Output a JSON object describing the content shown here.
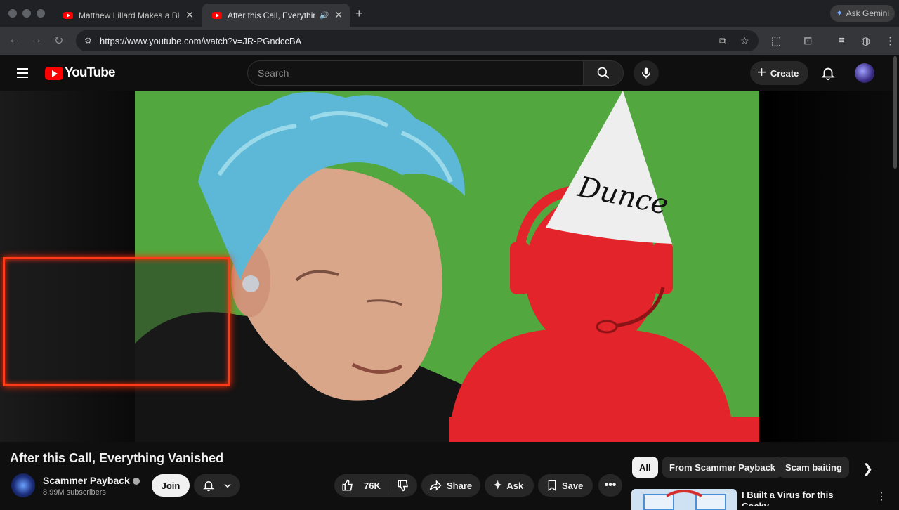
{
  "browser": {
    "tabs": [
      {
        "title": "Matthew Lillard Makes a Bloo",
        "active": false
      },
      {
        "title": "After this Call, Everything",
        "active": true
      }
    ],
    "ask_gemini": "Ask Gemini",
    "url": "https://www.youtube.com/watch?v=JR-PGndccBA"
  },
  "youtube": {
    "logo_text": "YouTube",
    "search_placeholder": "Search",
    "create_label": "Create",
    "video": {
      "hat_text": "Dunce",
      "title": "After this Call, Everything Vanished"
    },
    "channel": {
      "name": "Scammer Payback",
      "subscribers": "8.99M subscribers",
      "join_label": "Join"
    },
    "actions": {
      "likes": "76K",
      "share": "Share",
      "ask": "Ask",
      "save": "Save"
    },
    "chips": [
      "All",
      "From Scammer Payback",
      "Scam baiting"
    ],
    "recommendation": {
      "title": "I Built a Virus for this Cocky"
    }
  },
  "colors": {
    "brand_red": "#ff0000",
    "chip_bg": "#272727",
    "background": "#0f0f0f"
  }
}
